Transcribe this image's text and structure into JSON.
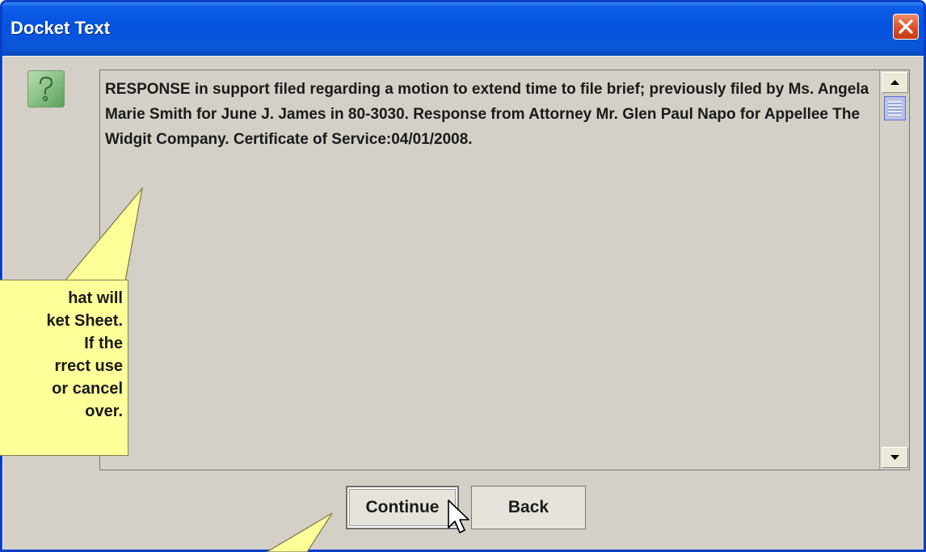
{
  "window": {
    "title": "Docket Text"
  },
  "docket": {
    "text": "RESPONSE in support filed regarding a motion to extend time to file brief; previously filed by Ms. Angela Marie Smith for June J. James in 80-3030. Response from Attorney Mr. Glen Paul Napo for Appellee The Widgit Company. Certificate of Service:04/01/2008."
  },
  "buttons": {
    "continue_label": "Continue",
    "back_label": "Back"
  },
  "callout": {
    "lines": [
      "hat will",
      "ket Sheet.",
      "If the",
      "rrect use",
      "or cancel",
      "over."
    ]
  },
  "icons": {
    "question": "question-icon",
    "close": "close-icon",
    "cursor": "mouse-pointer-icon"
  },
  "colors": {
    "titlebar": "#0554e0",
    "callout": "#ffff99",
    "dialog_bg": "#d4d0c8"
  }
}
